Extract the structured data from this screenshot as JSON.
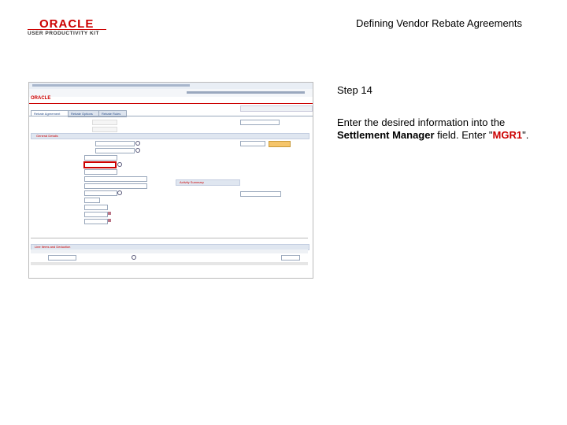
{
  "header": {
    "logo_brand": "ORACLE",
    "logo_product": "USER PRODUCTIVITY KIT",
    "title": "Defining Vendor Rebate Agreements"
  },
  "step": {
    "label": "Step 14",
    "instruction_pre": "Enter the desired information into the ",
    "instruction_field": "Settlement Manager",
    "instruction_mid": " field. Enter \"",
    "instruction_value": "MGR1",
    "instruction_post": "\"."
  },
  "screenshot": {
    "app_logo": "ORACLE",
    "tabs": [
      "Rebate Agreement",
      "Rebate Options",
      "Rebate Rules"
    ],
    "section_general": "General Details",
    "section_activity": "Activity Summary",
    "section_lines": "Line Items and Deduction"
  },
  "colors": {
    "accent": "#cc0000",
    "instruction_highlight": "#cc0000"
  }
}
